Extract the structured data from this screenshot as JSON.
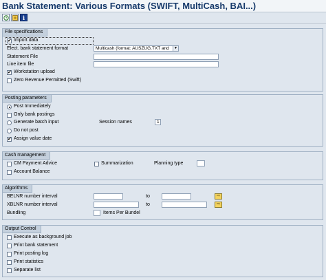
{
  "title": "Bank Statement: Various Formats (SWIFT, MultiCash, BAI...)",
  "toolbar": {
    "execute_icon": "execute-clock-icon",
    "variant_icon": "save-variant-icon",
    "info_glyph": "i"
  },
  "file_spec": {
    "title": "File specifications",
    "import_data": "Import data",
    "format_label": "Elect. bank statement format",
    "format_value": "Multicash (format: AUSZUG.TXT and",
    "statement_file": "Statement File",
    "line_item_file": "Line item file",
    "workstation_upload": "Workstation upload",
    "zero_revenue": "Zero Revenue Permitted (Swift)"
  },
  "posting": {
    "title": "Posting parameters",
    "post_immediately": "Post Immediately",
    "only_bank": "Only bank postings",
    "generate_batch": "Generate batch input",
    "session_names_label": "Session names",
    "session_names_value": "1",
    "do_not_post": "Do not post",
    "assign_value_date": "Assign value date"
  },
  "cash": {
    "title": "Cash management",
    "cm_payment_advice": "CM Payment Advice",
    "summarization": "Summarization",
    "planning_type": "Planning type",
    "account_balance": "Account Balance"
  },
  "algorithms": {
    "title": "Algorithms",
    "belnr": "BELNR number interval",
    "xblnr": "XBLNR number interval",
    "to1": "to",
    "to2": "to",
    "bundling": "Bundling",
    "items_per_bundle": "Items Per Bundel",
    "multisel_glyph": "⇨"
  },
  "output": {
    "title": "Output Control",
    "execute_bg": "Execute as background job",
    "print_bank": "Print bank statement",
    "print_posting": "Print posting log",
    "print_stats": "Print statistics",
    "separate_list": "Separate list"
  }
}
